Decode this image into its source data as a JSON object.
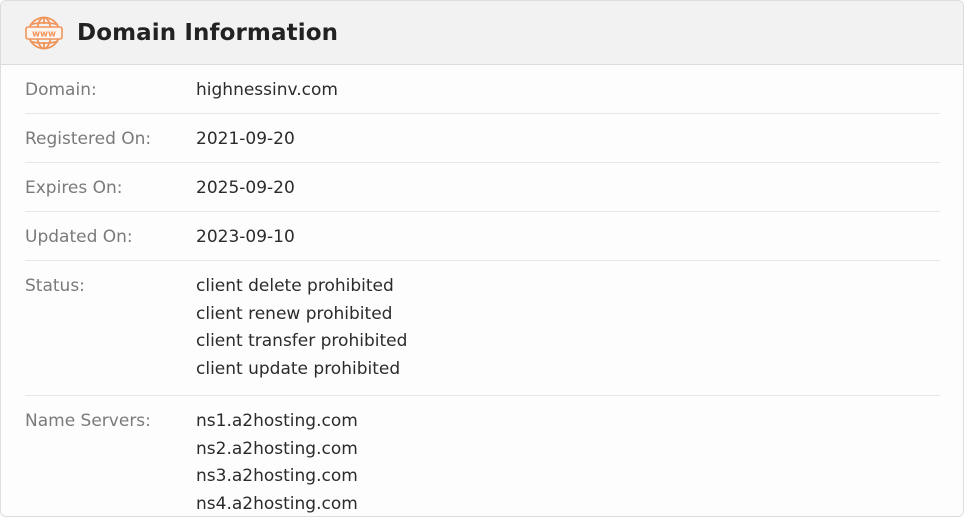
{
  "header": {
    "title": "Domain Information",
    "icon": "www-globe-icon",
    "icon_text": "www",
    "accent_color": "#f0955a"
  },
  "fields": {
    "domain": {
      "label": "Domain:",
      "value": "highnessinv.com"
    },
    "registered": {
      "label": "Registered On:",
      "value": "2021-09-20"
    },
    "expires": {
      "label": "Expires On:",
      "value": "2025-09-20"
    },
    "updated": {
      "label": "Updated On:",
      "value": "2023-09-10"
    },
    "status": {
      "label": "Status:",
      "values": [
        "client delete prohibited",
        "client renew prohibited",
        "client transfer prohibited",
        "client update prohibited"
      ]
    },
    "name_servers": {
      "label": "Name Servers:",
      "values": [
        "ns1.a2hosting.com",
        "ns2.a2hosting.com",
        "ns3.a2hosting.com",
        "ns4.a2hosting.com"
      ]
    }
  }
}
